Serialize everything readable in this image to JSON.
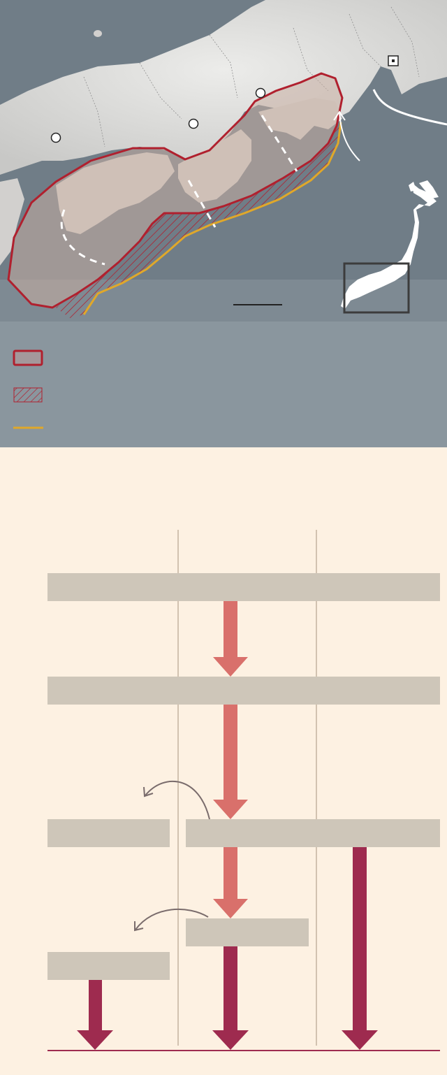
{
  "map": {
    "features": [
      "land-relief",
      "sea",
      "prefecture-borders",
      "source-zone-outline",
      "hatched-zone",
      "trough-line",
      "segment-boundaries",
      "city-markers",
      "capital-marker",
      "plate-motion-arrow",
      "inset-japan-map",
      "scale-bar"
    ],
    "colors": {
      "sea": "#6f7c86",
      "land": "#dcdcda",
      "zone_fill": "#c9aea3",
      "zone_outline": "#b0202e",
      "trough": "#e0a82a",
      "inset_frame": "#3c3c3c"
    }
  },
  "legend": {
    "items": [
      {
        "symbol": "outlined-box",
        "color": "#b0202e"
      },
      {
        "symbol": "hatched-box",
        "color": "#b0202e"
      },
      {
        "symbol": "line",
        "color": "#e0a82a"
      }
    ]
  },
  "flow": {
    "colors": {
      "box": "#cec6b9",
      "arrow_light": "#d9706b",
      "arrow_dark": "#9e2b4f",
      "guide": "#d2c2b0",
      "curve": "#7a6c6c"
    }
  }
}
